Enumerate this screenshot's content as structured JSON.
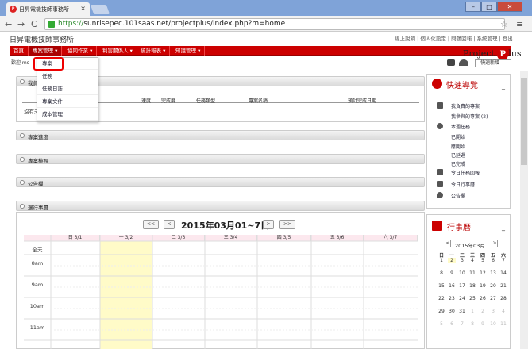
{
  "browser": {
    "tab_title": "日昇電機技師事務所",
    "tab_close": "×",
    "url_scheme": "https://",
    "url_host": "sunrisepec.101saas.net",
    "url_path": "/projectplus/index.php?m=home",
    "back": "←",
    "forward": "→",
    "reload": "C",
    "win_min": "–",
    "win_max": "□",
    "win_close": "✕",
    "menu": "≡",
    "star": "☆"
  },
  "site": {
    "title": "日昇電機技師事務所",
    "top_links": "線上說明 | 個人化設定 | 問題回報 | 系統管理 | 登出",
    "welcome": "歡迎 ms",
    "logo_text": "Project",
    "logo_mark": "P",
    "logo_tail": "lus",
    "quick_new": "- 快速新增 -"
  },
  "nav": [
    {
      "label": "首頁"
    },
    {
      "label": "專案管理 ▾"
    },
    {
      "label": "協同作業 ▾"
    },
    {
      "label": "利害關係人 ▾"
    },
    {
      "label": "統計報表 ▾"
    },
    {
      "label": "知識管理 ▾"
    }
  ],
  "dropdown": [
    "專案",
    "任務",
    "任務日誌",
    "專案文件",
    "成本管理"
  ],
  "sections": {
    "tasks": "我負",
    "progress": "專案進度",
    "review": "專案檢視",
    "board": "公告欄",
    "weekly": "週行事曆"
  },
  "task_table": {
    "headers": [
      "速度",
      "完成度",
      "任務類型",
      "專案名稱",
      "預計完成日期"
    ],
    "empty": "沒有未"
  },
  "week": {
    "title": "2015年03月01~7日",
    "btn_prev2": "<<",
    "btn_prev": "<",
    "btn_next": ">",
    "btn_next2": ">>",
    "days": [
      "日 3/1",
      "一 3/2",
      "二 3/3",
      "三 3/4",
      "四 3/5",
      "五 3/6",
      "六 3/7"
    ],
    "hours": [
      "全天",
      "8am",
      "9am",
      "10am",
      "11am"
    ]
  },
  "quick_nav": {
    "title": "快速導覽",
    "min": "_",
    "items": [
      "我負責的專案",
      "我參與的專案 (2)",
      "本週任務",
      "已開始",
      "應開始",
      "已延遲",
      "已完成",
      "今日任務回報",
      "今日行事曆",
      "公告欄"
    ]
  },
  "mini_cal": {
    "title": "行事曆",
    "min": "_",
    "month": "2015年03月",
    "prev": "<",
    "next": ">",
    "weekdays": [
      "日",
      "一",
      "二",
      "三",
      "四",
      "五",
      "六"
    ],
    "weeks": [
      [
        "1",
        "2",
        "3",
        "4",
        "5",
        "6",
        "7"
      ],
      [
        "8",
        "9",
        "10",
        "11",
        "12",
        "13",
        "14"
      ],
      [
        "15",
        "16",
        "17",
        "18",
        "19",
        "20",
        "21"
      ],
      [
        "22",
        "23",
        "24",
        "25",
        "26",
        "27",
        "28"
      ],
      [
        "29",
        "30",
        "31",
        "1",
        "2",
        "3",
        "4"
      ],
      [
        "5",
        "6",
        "7",
        "8",
        "9",
        "10",
        "11"
      ]
    ]
  }
}
